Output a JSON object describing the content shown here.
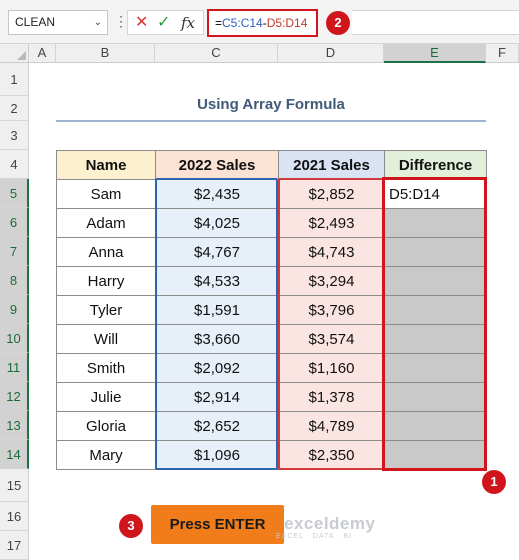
{
  "formula_bar": {
    "name_box": "CLEAN",
    "dropdown_glyph": "⌄",
    "options_glyph": "⋮",
    "cancel_glyph": "✕",
    "enter_glyph": "✓",
    "fx_label": "fx",
    "formula_prefix": "=",
    "formula_ref1": "C5:C14",
    "formula_op": "-",
    "formula_ref2": "D5:D14"
  },
  "columns": [
    "A",
    "B",
    "C",
    "D",
    "E",
    "F"
  ],
  "rows": [
    "1",
    "2",
    "3",
    "4",
    "5",
    "6",
    "7",
    "8",
    "9",
    "10",
    "11",
    "12",
    "13",
    "14",
    "15",
    "16",
    "17"
  ],
  "title": "Using Array Formula",
  "table": {
    "headers": [
      "Name",
      "2022 Sales",
      "2021 Sales",
      "Difference"
    ],
    "edit_cell": "D5:D14",
    "rows": [
      {
        "name": "Sam",
        "s2022": "$2,435",
        "s2021": "$2,852"
      },
      {
        "name": "Adam",
        "s2022": "$4,025",
        "s2021": "$2,493"
      },
      {
        "name": "Anna",
        "s2022": "$4,767",
        "s2021": "$4,743"
      },
      {
        "name": "Harry",
        "s2022": "$4,533",
        "s2021": "$3,294"
      },
      {
        "name": "Tyler",
        "s2022": "$1,591",
        "s2021": "$3,796"
      },
      {
        "name": "Will",
        "s2022": "$3,660",
        "s2021": "$3,574"
      },
      {
        "name": "Smith",
        "s2022": "$2,092",
        "s2021": "$1,160"
      },
      {
        "name": "Julie",
        "s2022": "$2,914",
        "s2021": "$1,378"
      },
      {
        "name": "Gloria",
        "s2022": "$2,652",
        "s2021": "$4,789"
      },
      {
        "name": "Mary",
        "s2022": "$1,096",
        "s2021": "$2,350"
      }
    ]
  },
  "badges": [
    "1",
    "2",
    "3"
  ],
  "enter_button": "Press ENTER",
  "watermark": {
    "brand": "exceldemy",
    "tagline": "EXCEL · DATA · BI"
  },
  "colors": {
    "accent_red": "#d0161c",
    "button_orange": "#f07d1a",
    "excel_green": "#1e7145"
  }
}
